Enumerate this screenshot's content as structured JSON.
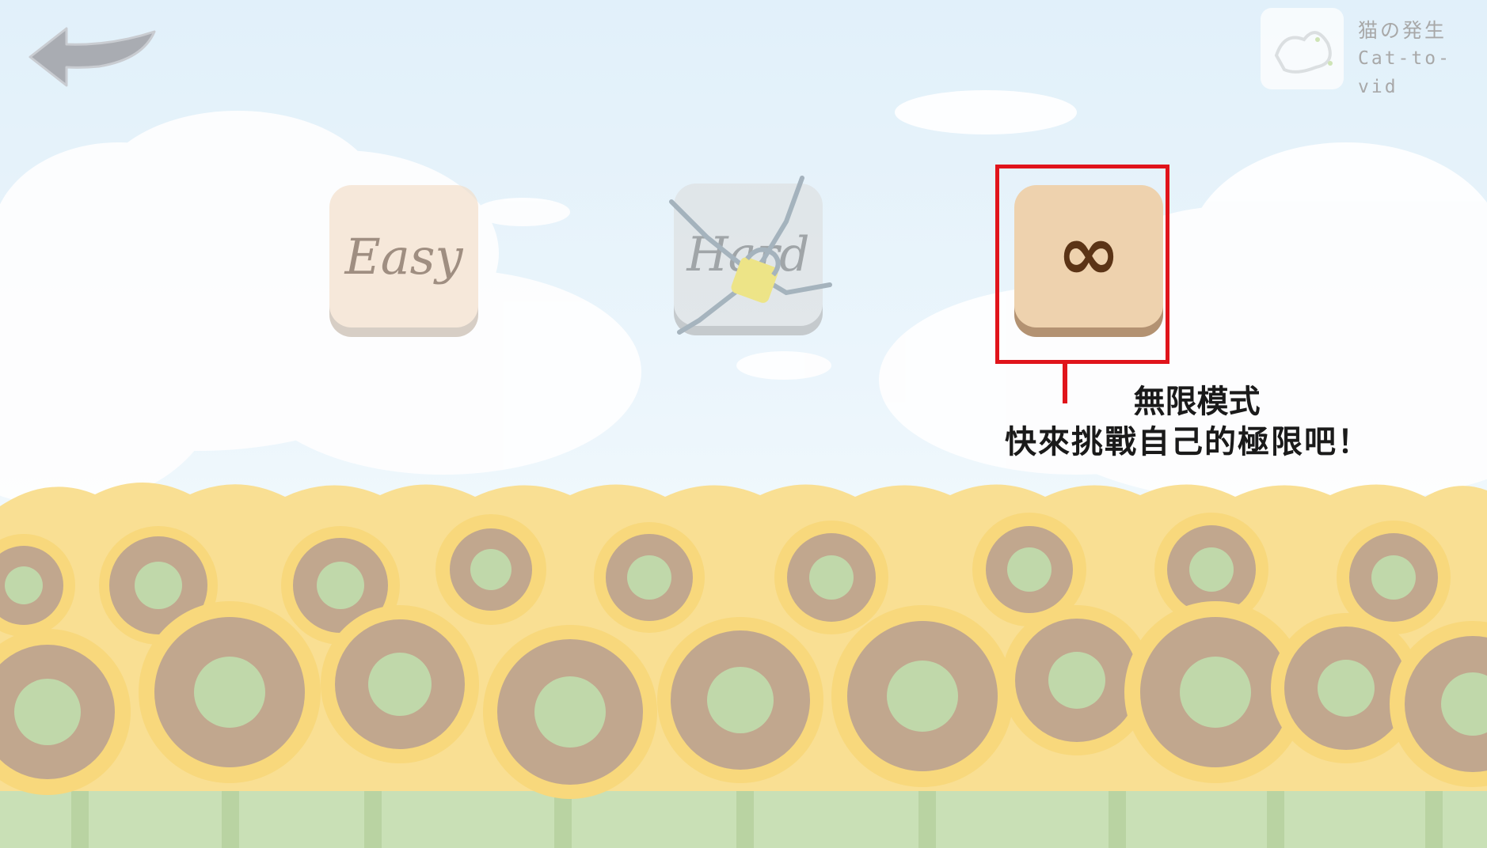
{
  "header": {
    "back_icon": "back-arrow-icon",
    "logo": {
      "line1": "猫の発生",
      "line2": "Cat-to-vid"
    }
  },
  "modes": [
    {
      "id": "easy",
      "label": "Easy",
      "state": "dimmed"
    },
    {
      "id": "hard",
      "label": "Hard",
      "state": "locked",
      "overlay_icon": "chain-lock-icon"
    },
    {
      "id": "infinite",
      "label": "∞",
      "state": "highlighted"
    }
  ],
  "callout": {
    "title": "無限模式",
    "description": "快來挑戰自己的極限吧！",
    "color": "#e0141b"
  },
  "colors": {
    "sky": "#d6ebf8",
    "sunflower_petal": "#f5c94a",
    "sunflower_center": "#a98563",
    "stem": "#a8c98a"
  }
}
